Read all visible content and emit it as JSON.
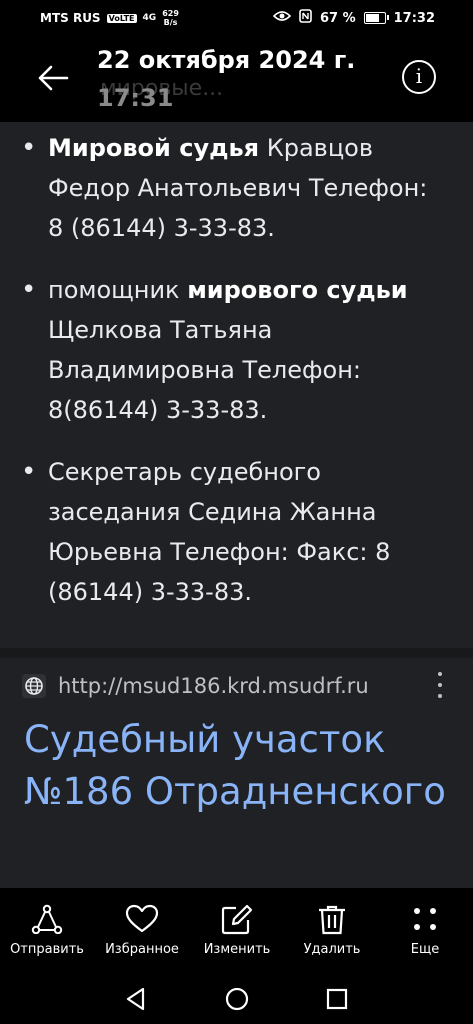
{
  "status_bar": {
    "carrier": "MTS RUS",
    "volte": "VoLTE",
    "signal": "4G",
    "net_rate": "629",
    "net_rate_unit": "B/s",
    "battery": "67 %",
    "time": "17:32"
  },
  "header": {
    "date": "22 октября 2024 г.",
    "time": "17:31",
    "ghost_text": "мировые..."
  },
  "content": {
    "items": [
      {
        "bold": "Мировой судья",
        "text": " Кравцов Федор Анатольевич Телефон: 8 (86144) 3-33-83."
      },
      {
        "pre": "помощник ",
        "bold": "мирового судьи",
        "text": " Щелкова Татьяна Владимировна Телефон: 8(86144) 3-33-83."
      },
      {
        "text": "Секретарь судебного заседания Седина Жанна Юрьевна Телефон: Факс: 8 (86144) 3-33-83."
      }
    ],
    "url": "http://msud186.krd.msudrf.ru",
    "result_title": "Судебный участок №186 Отрадненского"
  },
  "actions": [
    {
      "label": "Отправить",
      "icon": "share-icon"
    },
    {
      "label": "Избранное",
      "icon": "heart-icon"
    },
    {
      "label": "Изменить",
      "icon": "edit-icon"
    },
    {
      "label": "Удалить",
      "icon": "trash-icon"
    },
    {
      "label": "Еще",
      "icon": "more-grid-icon"
    }
  ],
  "colors": {
    "link": "#8ab4f8",
    "background": "#202124"
  }
}
